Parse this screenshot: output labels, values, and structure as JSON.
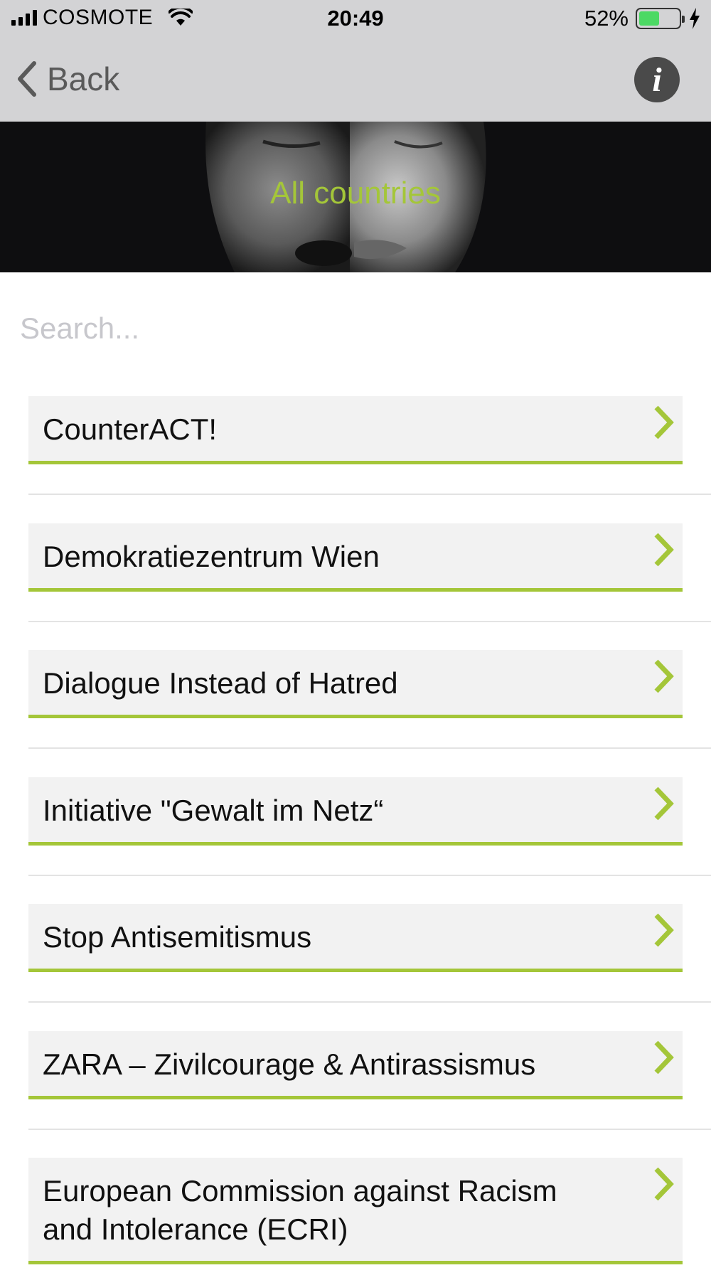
{
  "status_bar": {
    "carrier": "COSMOTE",
    "time": "20:49",
    "battery_percent": "52%",
    "battery_level": 0.52,
    "battery_color": "#4cd964"
  },
  "nav": {
    "back_label": "Back",
    "back_icon": "chevron-left-icon",
    "info_icon_label": "i"
  },
  "banner": {
    "title": "All countries",
    "title_color": "#a4c639"
  },
  "search": {
    "placeholder": "Search..."
  },
  "accent_color": "#a4c639",
  "organizations": [
    {
      "label": "CounterACT!"
    },
    {
      "label": "Demokratiezentrum Wien"
    },
    {
      "label": "Dialogue Instead of Hatred"
    },
    {
      "label": "Initiative \"Gewalt im Netz“"
    },
    {
      "label": "Stop Antisemitismus"
    },
    {
      "label": "ZARA – Zivilcourage & Antirassismus"
    },
    {
      "label": "European Commission against Racism\nand Intolerance (ECRI)"
    }
  ]
}
